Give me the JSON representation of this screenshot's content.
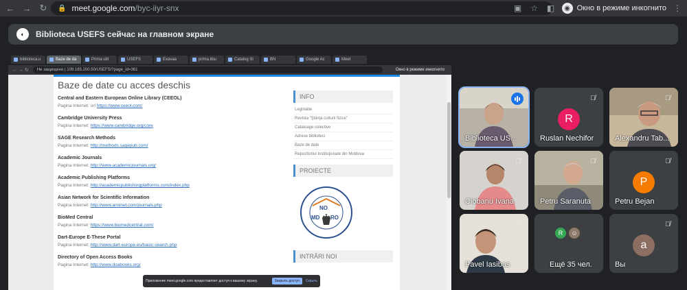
{
  "browser": {
    "url_host": "meet.google.com",
    "url_path": "/byc-iiyr-snx",
    "incognito_label": "Окно в режиме инкогнито"
  },
  "banner": {
    "text": "Biblioteca USEFS сейчас на главном экране"
  },
  "shared_screen": {
    "tabs": [
      "biblioteca.u",
      "Baze de da",
      "Prima util",
      "USEFS",
      "Exavaa",
      "prima.libu",
      "Catalog Sl",
      "BN",
      "Google Ac",
      "Meet"
    ],
    "inner_url": "Не защищено | 109.185.200.50/USEFS/?page_id=361",
    "inner_incognito": "Окно в режиме инкогнито",
    "page_title": "Baze de date cu acces deschis",
    "link_prefix": "Pagina Internet:",
    "databases": [
      {
        "name": "Central and Eastern European Online Library (CEEOL)",
        "link": "https://www.ceeol.com/",
        "prefix": "Pagina Internet: url"
      },
      {
        "name": "Cambridge University Press",
        "link": "https://www.cambridge.org/core",
        "prefix": "Pagina Internet:"
      },
      {
        "name": "SAGE Research Methods",
        "link": "http://methods.sagepub.com/",
        "prefix": "Pagina Internet:"
      },
      {
        "name": "Academic Journals",
        "link": "http://www.academicjournals.org/",
        "prefix": "Pagina Internet:"
      },
      {
        "name": "Academic Publishing Platforms",
        "link": "http://academicpublishingplatforms.com/index.php",
        "prefix": "Pagina Internet:"
      },
      {
        "name": "Asian Network for Scientific Information",
        "link": "http://www.ansinet.com/journals.php",
        "prefix": "Pagina Internet:"
      },
      {
        "name": "BioMed Central",
        "link": "https://www.biomedcentral.com/",
        "prefix": "Pagina Internet:"
      },
      {
        "name": "Dart-Europe E-These Portal",
        "link": "http://www.dart-europe.eu/basic-search.php",
        "prefix": "Pagina Internet:"
      },
      {
        "name": "Directory of Open Access Books",
        "link": "http://www.doabooks.org/",
        "prefix": "Pagina Internet:"
      }
    ],
    "sidebar": {
      "info_heading": "INFO",
      "info_links": [
        "Legislatie",
        "Revista \"Ştiinţa culturii fizice\"",
        "Cataloage colective",
        "Adrese biblioteci",
        "Baze de date",
        "Repozitoriul Instituţionale din Moldova"
      ],
      "projects_heading": "PROIECTE",
      "news_heading": "INTRĂRI NOI"
    },
    "share_bar": {
      "message": "Приложение meet.google.com предоставляет доступ к вашему экрану.",
      "stop_label": "Закрыть доступ",
      "hide_label": "Скрыть"
    }
  },
  "participants": [
    {
      "name": "Biblioteca US...",
      "speaking": true
    },
    {
      "name": "Ruslan Nechifor",
      "initial": "R",
      "color": "#e91e63"
    },
    {
      "name": "Alexandru Tab..."
    },
    {
      "name": "Ciobanu Ivana"
    },
    {
      "name": "Petru Saranuta"
    },
    {
      "name": "Petru Bejan",
      "initial": "P",
      "color": "#f57c00"
    },
    {
      "name": "Pavel Iasibas"
    },
    {
      "name": "Ещё 35 чел.",
      "mini_initial": "R",
      "mini_color": "#34a853"
    },
    {
      "name": "Вы",
      "initial": "a",
      "color": "#8d6e63"
    }
  ],
  "colors": {
    "accent": "#1a73e8",
    "tile_bg": "#3c4043",
    "page_bg": "#202124"
  }
}
